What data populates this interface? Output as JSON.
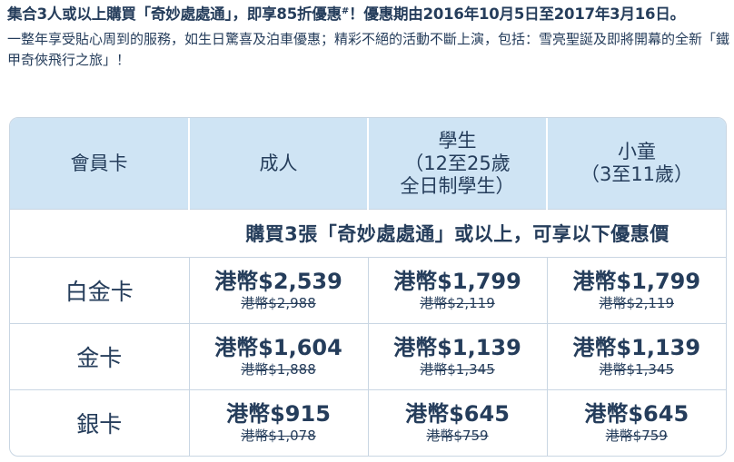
{
  "intro": {
    "headline": "集合3人或以上購買「奇妙處處通」，即享85折優惠",
    "headline_mark": "#",
    "headline_end": "！優惠期由2016年10月5日至2017年3月16日。",
    "description": "一整年享受貼心周到的服務，如生日驚喜及泊車優惠；精彩不絕的活動不斷上演，包括：雪亮聖誕及即將開幕的全新「鐵甲奇俠飛行之旅」！"
  },
  "table": {
    "headers": {
      "membership": "會員卡",
      "adult": "成人",
      "student": "學生\n（12至25歲\n全日制學生）",
      "child": "小童\n（3至11歲）"
    },
    "promo_note": "購買3張「奇妙處處通」或以上，可享以下優惠價",
    "rows": [
      {
        "tier": "白金卡",
        "adult": {
          "now": "港幣$2,539",
          "was": "港幣$2,988"
        },
        "student": {
          "now": "港幣$1,799",
          "was": "港幣$2,119"
        },
        "child": {
          "now": "港幣$1,799",
          "was": "港幣$2,119"
        }
      },
      {
        "tier": "金卡",
        "adult": {
          "now": "港幣$1,604",
          "was": "港幣$1,888"
        },
        "student": {
          "now": "港幣$1,139",
          "was": "港幣$1,345"
        },
        "child": {
          "now": "港幣$1,139",
          "was": "港幣$1,345"
        }
      },
      {
        "tier": "銀卡",
        "adult": {
          "now": "港幣$915",
          "was": "港幣$1,078"
        },
        "student": {
          "now": "港幣$645",
          "was": "港幣$759"
        },
        "child": {
          "now": "港幣$645",
          "was": "港幣$759"
        }
      }
    ]
  },
  "colors": {
    "text": "#253d5b",
    "header_bg": "#cfe4f4",
    "border": "#c9d6e3"
  }
}
